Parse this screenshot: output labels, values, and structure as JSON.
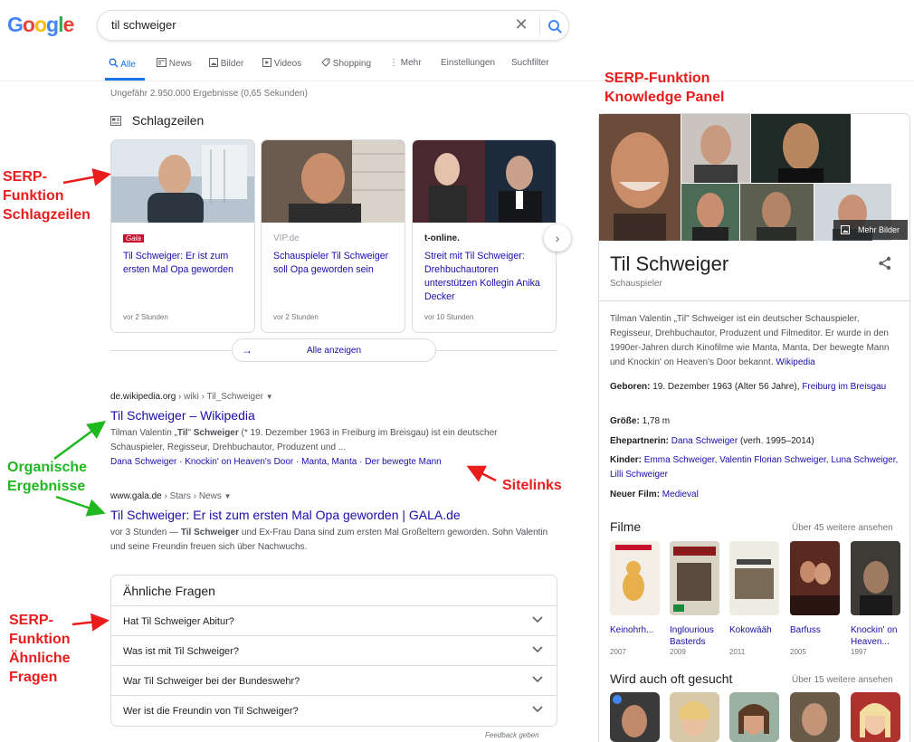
{
  "logo": [
    "G",
    "o",
    "o",
    "g",
    "l",
    "e"
  ],
  "search": {
    "query": "til schweiger"
  },
  "tabs": [
    {
      "label": "Alle",
      "icon": "search-icon"
    },
    {
      "label": "News",
      "icon": "news-icon"
    },
    {
      "label": "Bilder",
      "icon": "image-icon"
    },
    {
      "label": "Videos",
      "icon": "video-icon"
    },
    {
      "label": "Shopping",
      "icon": "tag-icon"
    },
    {
      "label": "Mehr",
      "icon": "more-vert-icon"
    },
    {
      "label": "Einstellungen"
    },
    {
      "label": "Suchfilter"
    }
  ],
  "results_count": "Ungefähr 2.950.000 Ergebnisse (0,65 Sekunden)",
  "headlines": {
    "title": "Schlagzeilen",
    "cards": [
      {
        "source": "Gala",
        "title": "Til Schweiger: Er ist zum ersten Mal Opa geworden",
        "time": "vor 2 Stunden"
      },
      {
        "source": "VIP.de",
        "title": "Schauspieler Til Schweiger soll Opa geworden sein",
        "time": "vor 2 Stunden"
      },
      {
        "source": "t-online.",
        "title": "Streit mit Til Schweiger: Drehbuchautoren unterstützen Kollegin Anika Decker",
        "time": "vor 10 Stunden"
      }
    ],
    "show_all": "Alle anzeigen"
  },
  "results": [
    {
      "domain": "de.wikipedia.org",
      "crumbs": " › wiki › Til_Schweiger",
      "title": "Til Schweiger – Wikipedia",
      "snippet_1": "Tilman Valentin „",
      "snippet_b1": "Til",
      "snippet_2": "\" ",
      "snippet_b2": "Schweiger",
      "snippet_3": " (* 19. Dezember 1963 in Freiburg im Breisgau) ist ein deutscher Schauspieler, Regisseur, Drehbuchautor, Produzent und ...",
      "sitelinks": [
        "Dana Schweiger",
        "Knockin' on Heaven's Door",
        "Manta, Manta",
        "Der bewegte Mann"
      ]
    },
    {
      "domain": "www.gala.de",
      "crumbs": " › Stars › News",
      "title": "Til Schweiger: Er ist zum ersten Mal Opa geworden | GALA.de",
      "snippet_1": "vor 3 Stunden — ",
      "snippet_b1": "Til Schweiger",
      "snippet_2": " und Ex-Frau Dana sind zum ersten Mal Großeltern geworden. Sohn Valentin und seine Freundin freuen sich über Nachwuchs."
    }
  ],
  "faq": {
    "title": "Ähnliche Fragen",
    "questions": [
      "Hat Til Schweiger Abitur?",
      "Was ist mit Til Schweiger?",
      "War Til Schweiger bei der Bundeswehr?",
      "Wer ist die Freundin von Til Schweiger?"
    ],
    "feedback": "Feedback geben"
  },
  "knowledge_panel": {
    "more_images": "Mehr Bilder",
    "name": "Til Schweiger",
    "subtitle": "Schauspieler",
    "description": "Tilman Valentin „Til\" Schweiger ist ein deutscher Schauspieler, Regisseur, Drehbuchautor, Produzent und Filmeditor. Er wurde in den 1990er-Jahren durch Kinofilme wie Manta, Manta, Der bewegte Mann und Knockin' on Heaven's Door bekannt.",
    "description_link": "Wikipedia",
    "facts": {
      "born_label": "Geboren:",
      "born_value": "19. Dezember 1963 (Alter 56 Jahre),",
      "born_place": "Freiburg im Breisgau",
      "height_label": "Größe:",
      "height_value": "1,78 m",
      "spouse_label": "Ehepartnerin:",
      "spouse_link": "Dana Schweiger",
      "spouse_value": "(verh. 1995–2014)",
      "children_label": "Kinder:",
      "children_links": "Emma Schweiger, Valentin Florian Schweiger, Luna Schweiger, Lilli Schweiger",
      "newfilm_label": "Neuer Film:",
      "newfilm_link": "Medieval"
    },
    "films_title": "Filme",
    "films_more": "Über 45 weitere ansehen",
    "films": [
      {
        "title": "Keinohrh...",
        "year": "2007"
      },
      {
        "title": "Inglourious Basterds",
        "year": "2009"
      },
      {
        "title": "Kokowääh",
        "year": "2011"
      },
      {
        "title": "Barfuss",
        "year": "2005"
      },
      {
        "title": "Knockin' on Heaven...",
        "year": "1997"
      }
    ],
    "also_title": "Wird auch oft gesucht",
    "also_more": "Über 15 weitere ansehen"
  },
  "annotations": {
    "kp": [
      "SERP-Funktion",
      "Knowledge Panel"
    ],
    "headlines": [
      "SERP-",
      "Funktion",
      "Schlagzeilen"
    ],
    "organic": [
      "Organische",
      "Ergebnisse"
    ],
    "sitelinks": "Sitelinks",
    "faq": [
      "SERP-",
      "Funktion",
      "Ähnliche",
      "Fragen"
    ]
  },
  "colors": {
    "accent": "#1a73e8",
    "link": "#1a0dab",
    "annotation_red": "#ea1d1d",
    "annotation_green": "#1fb81f"
  }
}
